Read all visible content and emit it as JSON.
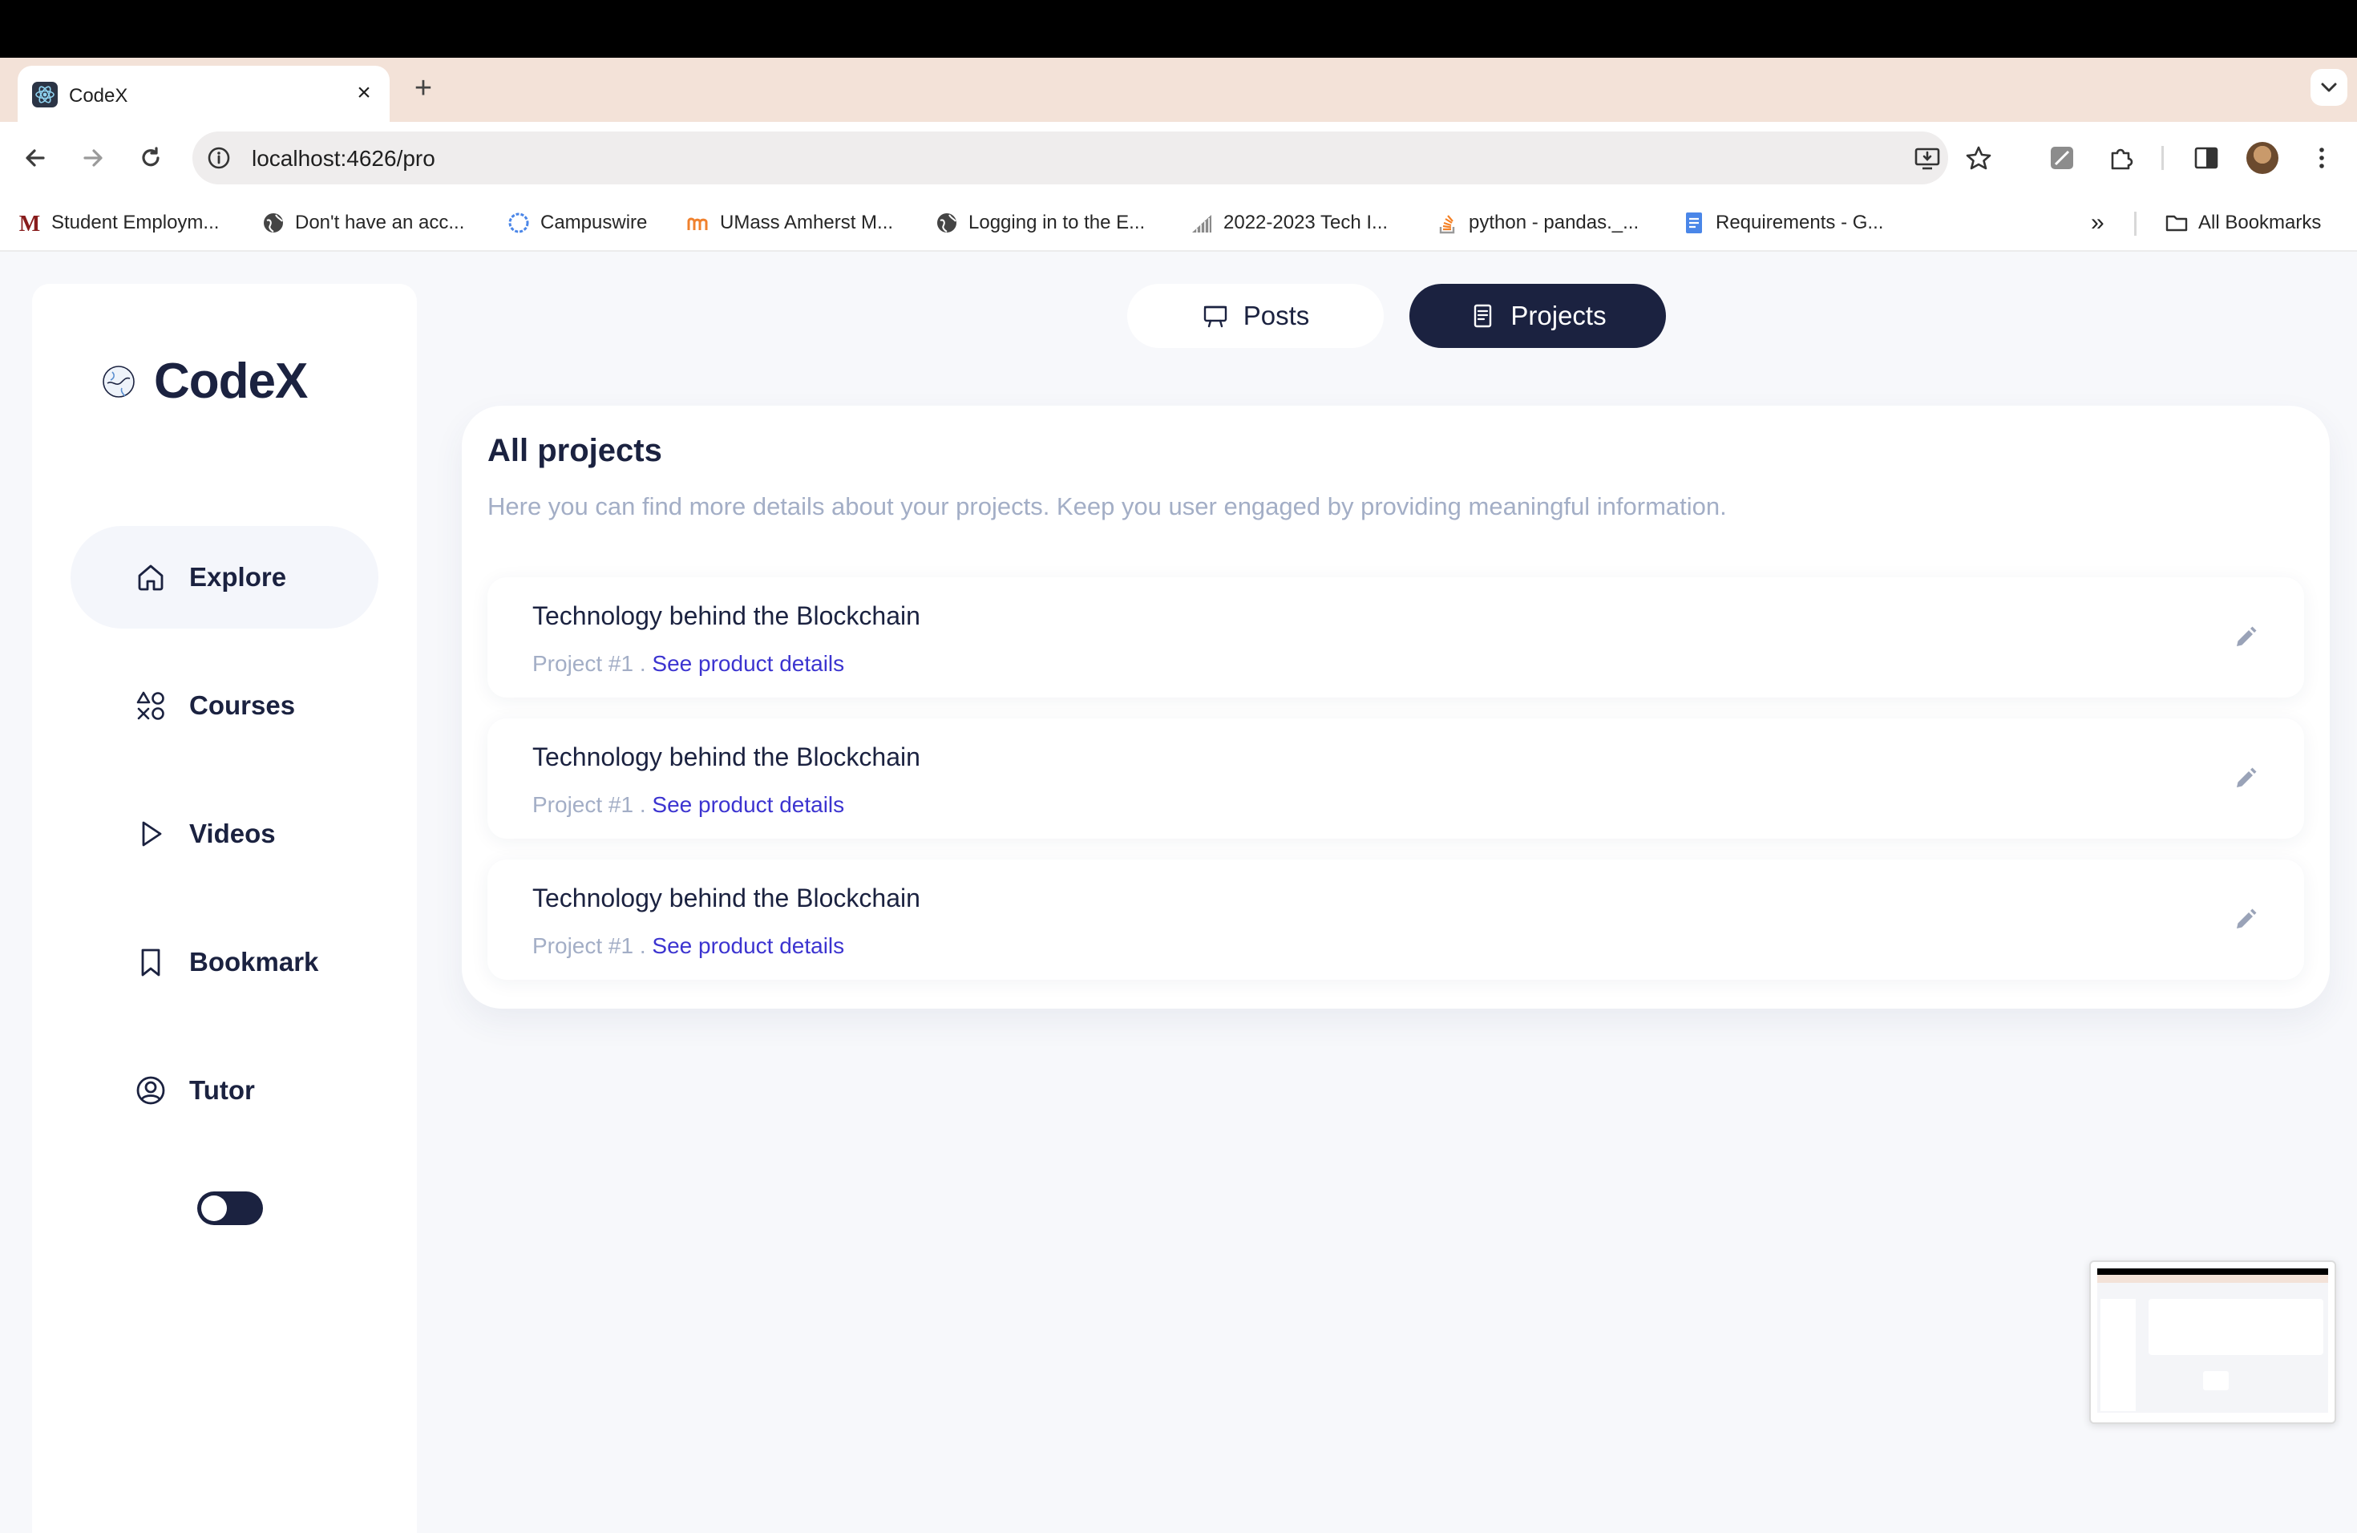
{
  "browser": {
    "tab_title": "CodeX",
    "tab_close": "×",
    "new_tab": "+",
    "url": "localhost:4626/pro",
    "bookmarks": [
      "Student Employm...",
      "Don't have an acc...",
      "Campuswire",
      "UMass Amherst M...",
      "Logging in to the E...",
      "2022-2023 Tech I...",
      "python - pandas._...",
      "Requirements - G..."
    ],
    "bookmarks_overflow": "»",
    "all_bookmarks": "All Bookmarks"
  },
  "sidebar": {
    "brand": "CodeX",
    "nav": [
      {
        "label": "Explore",
        "icon": "home-icon",
        "active": true
      },
      {
        "label": "Courses",
        "icon": "shapes-icon",
        "active": false
      },
      {
        "label": "Videos",
        "icon": "play-icon",
        "active": false
      },
      {
        "label": "Bookmark",
        "icon": "bookmark-icon",
        "active": false
      },
      {
        "label": "Tutor",
        "icon": "user-circle-icon",
        "active": false
      }
    ],
    "theme_toggle": "dark"
  },
  "segments": {
    "posts": "Posts",
    "projects": "Projects",
    "selected": "Projects"
  },
  "projects_card": {
    "title": "All projects",
    "subtitle": "Here you can find more details about your projects. Keep you user engaged by providing meaningful information.",
    "items": [
      {
        "title": "Technology behind the Blockchain",
        "number": "Project #1",
        "separator": " . ",
        "link": "See product details"
      },
      {
        "title": "Technology behind the Blockchain",
        "number": "Project #1",
        "separator": " . ",
        "link": "See product details"
      },
      {
        "title": "Technology behind the Blockchain",
        "number": "Project #1",
        "separator": " . ",
        "link": "See product details"
      }
    ]
  },
  "colors": {
    "navy": "#1b2240",
    "link": "#3c34d0",
    "muted": "#a3aec6",
    "tabstrip": "#f3e2d8"
  }
}
